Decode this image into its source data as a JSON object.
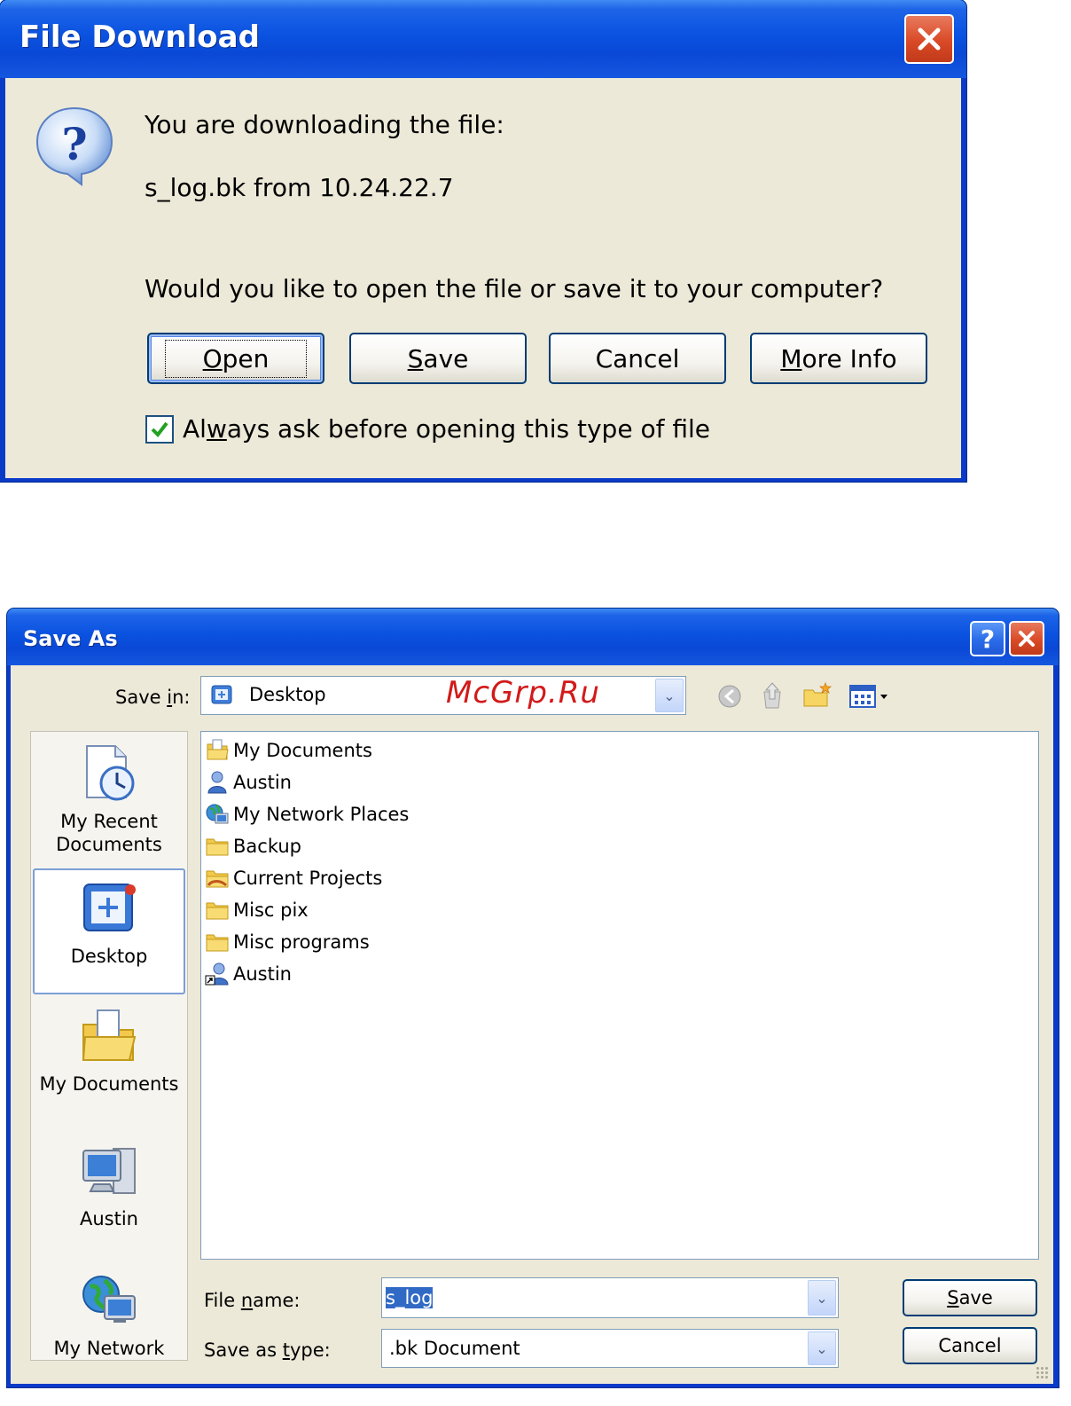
{
  "file_download": {
    "title": "File Download",
    "line1": "You are downloading the file:",
    "line2": "s_log.bk from 10.24.22.7",
    "question": "Would you like to open the file or save it to your computer?",
    "buttons": {
      "open": "pen",
      "open_key": "O",
      "save": "ave",
      "save_key": "S",
      "cancel": "Cancel",
      "more_info": "ore Info",
      "more_info_key": "M"
    },
    "checkbox": {
      "pre": "Al",
      "key": "w",
      "post": "ays ask before opening this type of file",
      "checked": true
    }
  },
  "save_as": {
    "title": "Save As",
    "save_in": {
      "pre": "Save ",
      "key": "i",
      "post": "n:",
      "value": "Desktop"
    },
    "watermark": "McGrp.Ru",
    "places": [
      "My Recent\nDocuments",
      "Desktop",
      "My Documents",
      "Austin",
      "My Network"
    ],
    "places_lines": {
      "recent1": "My Recent",
      "recent2": "Documents",
      "desktop": "Desktop",
      "docs": "My Documents",
      "austin": "Austin",
      "network": "My Network"
    },
    "items": [
      {
        "name": "My Documents",
        "icon": "my-documents-icon"
      },
      {
        "name": "Austin",
        "icon": "user-icon"
      },
      {
        "name": "My Network Places",
        "icon": "network-places-icon"
      },
      {
        "name": "Backup",
        "icon": "folder-icon"
      },
      {
        "name": "Current Projects",
        "icon": "shared-folder-icon"
      },
      {
        "name": "Misc pix",
        "icon": "folder-icon"
      },
      {
        "name": "Misc programs",
        "icon": "folder-icon"
      },
      {
        "name": "Austin",
        "icon": "user-shortcut-icon"
      }
    ],
    "file_name": {
      "pre": "File ",
      "key": "n",
      "post": "ame:",
      "value": "s_log"
    },
    "save_type": {
      "pre": "Save as ",
      "key": "t",
      "post": "ype:",
      "value": ".bk Document"
    },
    "buttons": {
      "save_key": "S",
      "save": "ave",
      "cancel": "Cancel"
    }
  },
  "colors": {
    "title_blue": "#0a52e0",
    "face": "#ece9d8",
    "close_red": "#d94a27",
    "watermark": "#d21a1a"
  }
}
